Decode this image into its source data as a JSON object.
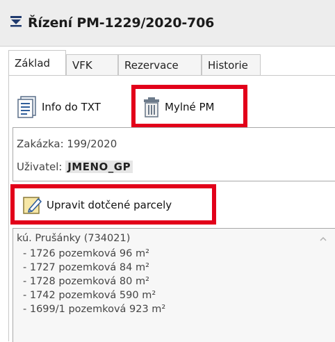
{
  "window": {
    "title": "Řízení PM-1229/2020-706"
  },
  "tabs": [
    {
      "label": "Základ"
    },
    {
      "label": "VFK"
    },
    {
      "label": "Rezervace"
    },
    {
      "label": "Historie"
    }
  ],
  "toolbar": {
    "info_label": "Info do TXT",
    "mylne_label": "Mylné PM",
    "upravit_label": "Upravit dotčené parcely"
  },
  "info": {
    "zakazka_label": "Zakázka:",
    "zakazka_value": "199/2020",
    "uzivatel_label": "Uživatel:",
    "uzivatel_value": "JMENO_GP"
  },
  "parcels": {
    "header": "kú. Prušánky (734021)",
    "items": [
      "- 1726 pozemková 96 m²",
      "- 1727 pozemková 84 m²",
      "- 1728 pozemková 80 m²",
      "- 1742 pozemková 590 m²",
      "- 1699/1 pozemková 923 m²"
    ]
  },
  "colors": {
    "highlight": "#e2001a",
    "titlebar": "#ededed"
  }
}
